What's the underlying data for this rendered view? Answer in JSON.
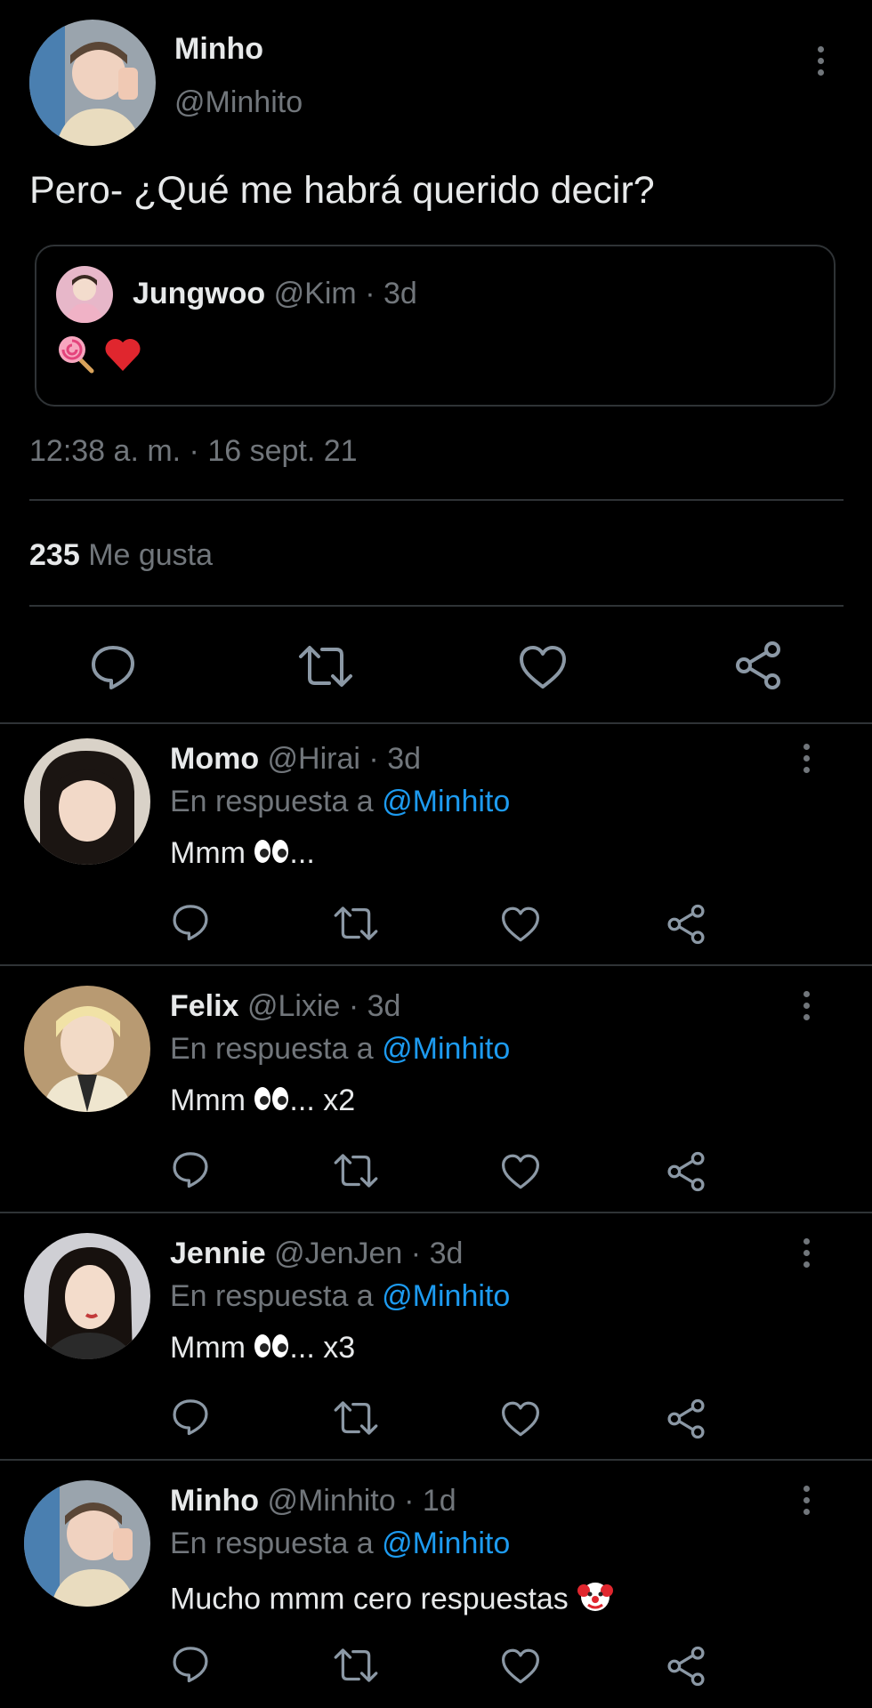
{
  "tweet": {
    "author_name": "Minho",
    "author_handle": "@Minhito",
    "text": "Pero- ¿Qué me habrá querido decir?",
    "quote": {
      "author_name": "Jungwoo",
      "author_handle": "@Kim",
      "separator": "·",
      "time": "3d",
      "emojis": [
        "lollipop-emoji",
        "heart-emoji"
      ]
    },
    "timestamp": "12:38 a. m. · 16 sept. 21",
    "likes_count": "235",
    "likes_label": "Me gusta",
    "actions": [
      "reply-icon",
      "retweet-icon",
      "like-icon",
      "share-icon"
    ]
  },
  "replies": [
    {
      "name": "Momo",
      "handle": "@Hirai",
      "separator": "·",
      "time": "3d",
      "reply_prefix": "En respuesta a",
      "reply_to": "@Minhito",
      "text_before": "Mmm",
      "text_after": "...",
      "emoji": "eyes-emoji"
    },
    {
      "name": "Felix",
      "handle": "@Lixie",
      "separator": "·",
      "time": "3d",
      "reply_prefix": "En respuesta a",
      "reply_to": "@Minhito",
      "text_before": "Mmm",
      "text_after": "... x2",
      "emoji": "eyes-emoji"
    },
    {
      "name": "Jennie",
      "handle": "@JenJen",
      "separator": "·",
      "time": "3d",
      "reply_prefix": "En respuesta a",
      "reply_to": "@Minhito",
      "text_before": "Mmm",
      "text_after": "... x3",
      "emoji": "eyes-emoji"
    },
    {
      "name": "Minho",
      "handle": "@Minhito",
      "separator": "·",
      "time": "1d",
      "reply_prefix": "En respuesta a",
      "reply_to": "@Minhito",
      "text_before": "Mucho mmm cero respuestas",
      "text_after": "",
      "emoji": "clown-emoji"
    }
  ],
  "colors": {
    "background": "#000000",
    "text": "#e7e9ea",
    "muted": "#71767b",
    "link": "#1d9bf0",
    "divider": "#2f3336"
  }
}
